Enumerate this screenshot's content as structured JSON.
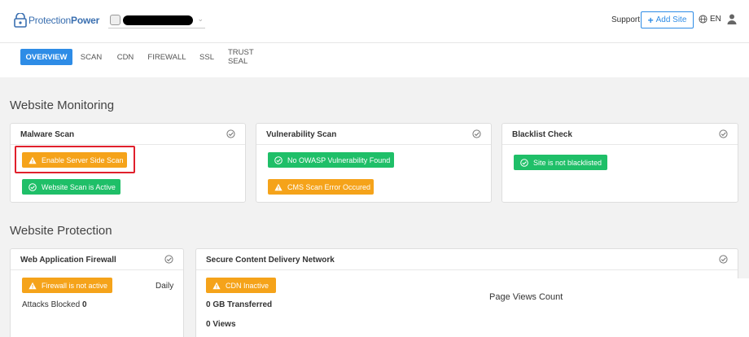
{
  "header": {
    "brand_prefix": "Protection",
    "brand_suffix": "Power",
    "support_label": "Support",
    "add_site_label": "Add Site",
    "language": "EN"
  },
  "tabs": [
    {
      "label": "OVERVIEW",
      "active": true
    },
    {
      "label": "SCAN",
      "active": false
    },
    {
      "label": "CDN",
      "active": false
    },
    {
      "label": "FIREWALL",
      "active": false
    },
    {
      "label": "SSL",
      "active": false
    },
    {
      "label": "TRUST SEAL",
      "active": false
    }
  ],
  "monitoring": {
    "title": "Website Monitoring",
    "malware": {
      "title": "Malware Scan",
      "status1": "Enable Server Side Scan",
      "status2": "Website Scan is Active"
    },
    "vulnerability": {
      "title": "Vulnerability Scan",
      "status1": "No OWASP Vulnerability Found",
      "status2": "CMS Scan Error Occured"
    },
    "blacklist": {
      "title": "Blacklist Check",
      "status1": "Site is not blacklisted"
    }
  },
  "protection": {
    "title": "Website Protection",
    "waf": {
      "title": "Web Application Firewall",
      "status": "Firewall is not active",
      "frequency": "Daily",
      "attacks_label": "Attacks Blocked",
      "attacks_value": "0"
    },
    "cdn": {
      "title": "Secure Content Delivery Network",
      "status": "CDN Inactive",
      "transferred_value": "0 GB",
      "transferred_label": "Transferred",
      "views_value": "0",
      "views_label": "Views"
    }
  },
  "page_views": {
    "title": "Page Views Count"
  },
  "colors": {
    "accent": "#2e8ce6",
    "warning": "#f5a31a",
    "success": "#1fbf68",
    "highlight": "#e0202c"
  }
}
